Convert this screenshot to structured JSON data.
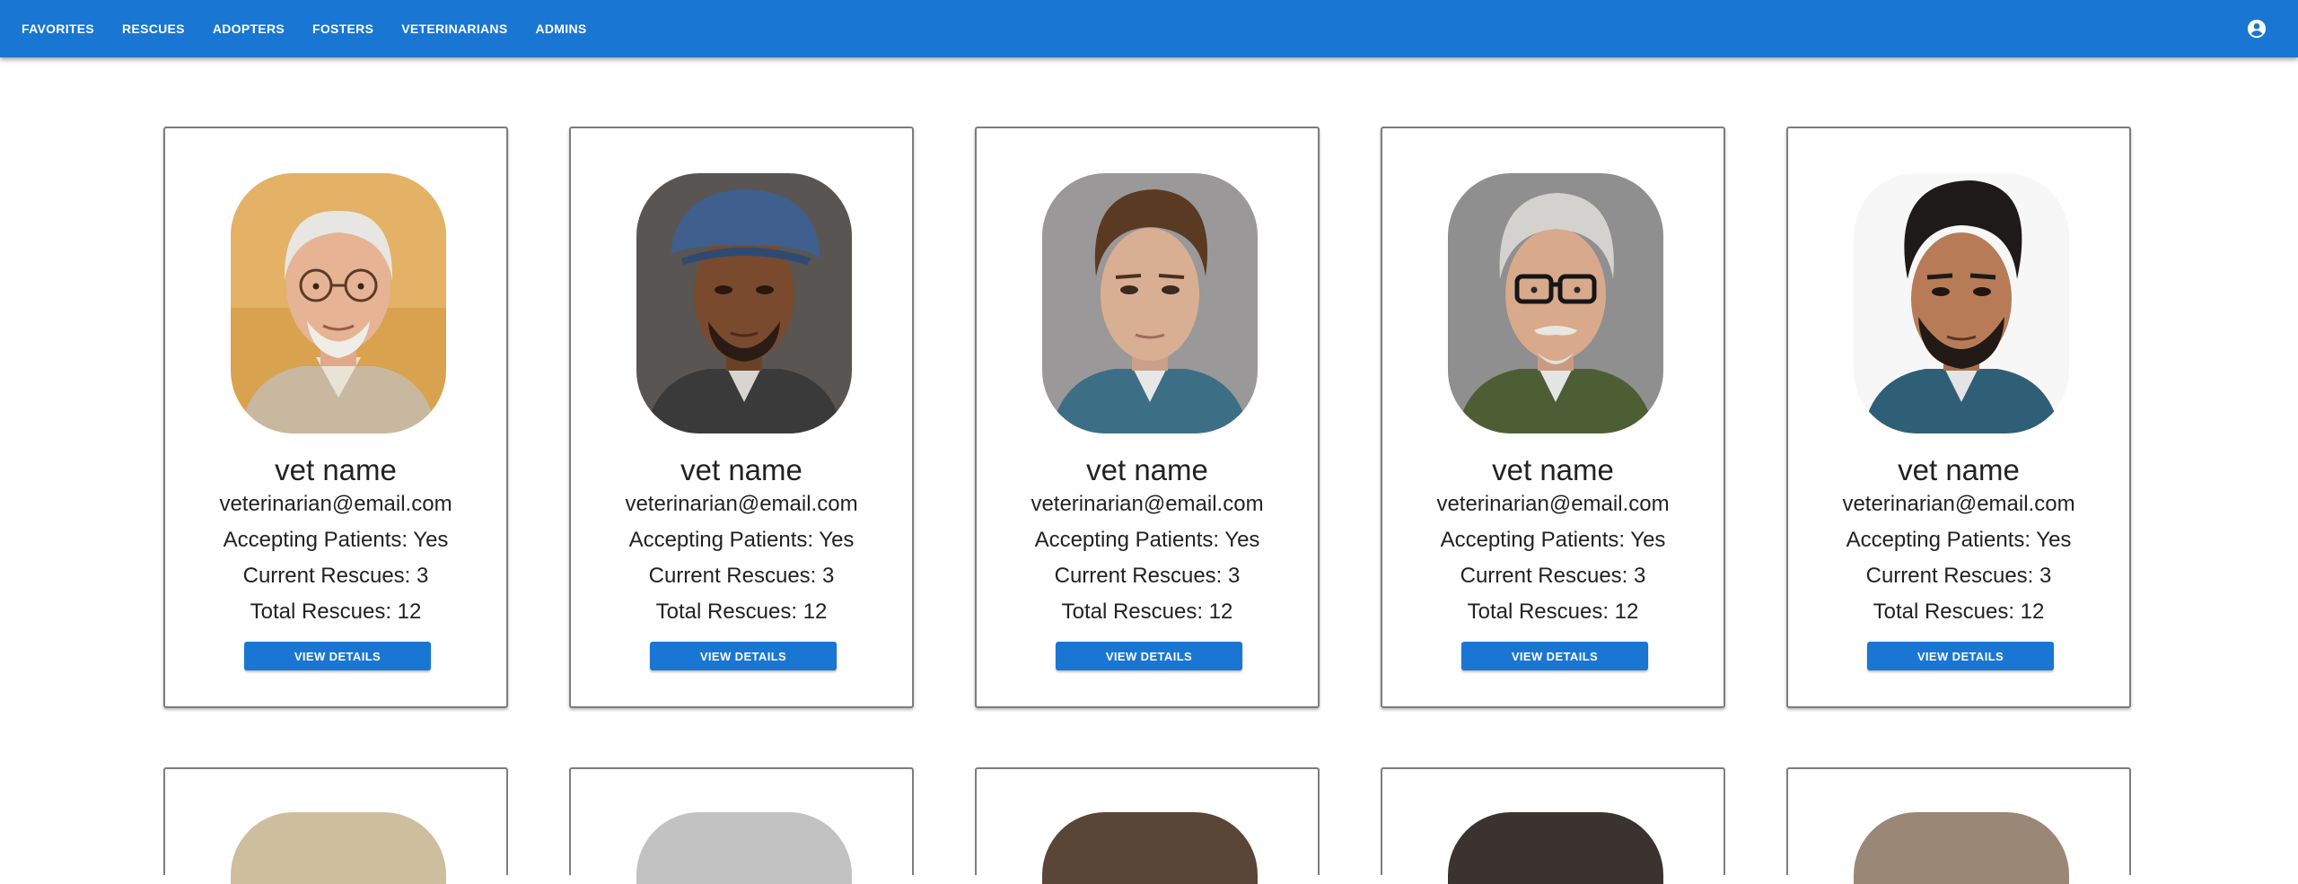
{
  "nav": {
    "items": [
      "FAVORITES",
      "RESCUES",
      "ADOPTERS",
      "FOSTERS",
      "VETERINARIANS",
      "ADMINS"
    ],
    "account_icon": "account-circle-icon"
  },
  "cards": [
    {
      "name": "vet name",
      "email": "veterinarian@email.com",
      "accepting": "Accepting Patients: Yes",
      "current": "Current Rescues: 3",
      "total": "Total Rescues: 12",
      "button": "VIEW DETAILS"
    },
    {
      "name": "vet name",
      "email": "veterinarian@email.com",
      "accepting": "Accepting Patients: Yes",
      "current": "Current Rescues: 3",
      "total": "Total Rescues: 12",
      "button": "VIEW DETAILS"
    },
    {
      "name": "vet name",
      "email": "veterinarian@email.com",
      "accepting": "Accepting Patients: Yes",
      "current": "Current Rescues: 3",
      "total": "Total Rescues: 12",
      "button": "VIEW DETAILS"
    },
    {
      "name": "vet name",
      "email": "veterinarian@email.com",
      "accepting": "Accepting Patients: Yes",
      "current": "Current Rescues: 3",
      "total": "Total Rescues: 12",
      "button": "VIEW DETAILS"
    },
    {
      "name": "vet name",
      "email": "veterinarian@email.com",
      "accepting": "Accepting Patients: Yes",
      "current": "Current Rescues: 3",
      "total": "Total Rescues: 12",
      "button": "VIEW DETAILS"
    }
  ],
  "colors": {
    "primary": "#1976d2",
    "text": "#222222"
  }
}
